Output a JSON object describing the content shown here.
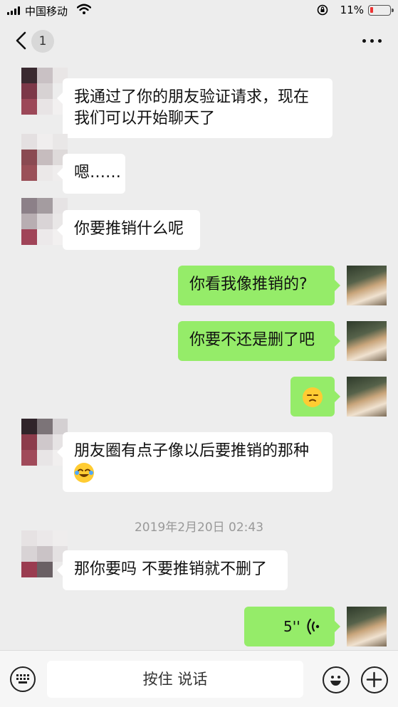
{
  "status_bar": {
    "carrier": "中国移动",
    "battery": "11%",
    "battery_level": 0.11,
    "icons": [
      "signal-icon",
      "wifi-icon",
      "rotation-lock-icon",
      "battery-icon"
    ]
  },
  "nav": {
    "back_icon": "chevron-left-icon",
    "unread_count": "1",
    "more_icon": "more-dots-icon"
  },
  "messages": [
    {
      "side": "in",
      "text": "我通过了你的朋友验证请求，现在我们可以开始聊天了"
    },
    {
      "side": "in",
      "text": "嗯……"
    },
    {
      "side": "in",
      "text": "你要推销什么呢"
    },
    {
      "side": "out",
      "text": "你看我像推销的?"
    },
    {
      "side": "out",
      "text": "你要不还是删了吧"
    },
    {
      "side": "out",
      "emoji": "unamused-face-icon"
    },
    {
      "side": "in",
      "text": "朋友圈有点子像以后要推销的那种",
      "emoji": "tears-of-joy-icon"
    },
    {
      "side": "in",
      "text": "那你要吗 不要推销就不删了"
    },
    {
      "side": "out",
      "voice": "5''",
      "icon": "voice-wave-icon"
    }
  ],
  "timestamp": "2019年2月20日 02:43",
  "input_bar": {
    "hold_to_talk": "按住 说话",
    "icons": [
      "keyboard-icon",
      "emoji-icon",
      "plus-icon"
    ]
  },
  "colors": {
    "background": "#ededed",
    "outgoing_bubble": "#95ec69",
    "incoming_bubble": "#ffffff",
    "battery_low": "#e33333"
  }
}
